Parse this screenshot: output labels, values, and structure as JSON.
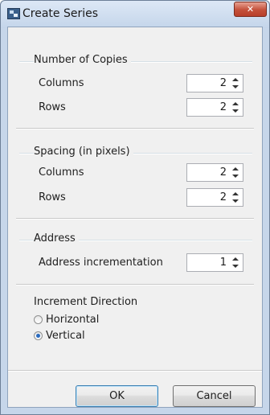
{
  "window": {
    "title": "Create Series",
    "close_symbol": "✕"
  },
  "copies": {
    "title": "Number of Copies",
    "columns_label": "Columns",
    "columns_value": "2",
    "rows_label": "Rows",
    "rows_value": "2"
  },
  "spacing": {
    "title": "Spacing (in pixels)",
    "columns_label": "Columns",
    "columns_value": "2",
    "rows_label": "Rows",
    "rows_value": "2"
  },
  "address": {
    "title": "Address",
    "increment_label": "Address incrementation",
    "increment_value": "1"
  },
  "direction": {
    "title": "Increment Direction",
    "options": [
      {
        "label": "Horizontal",
        "checked": false
      },
      {
        "label": "Vertical",
        "checked": true
      }
    ]
  },
  "buttons": {
    "ok": "OK",
    "cancel": "Cancel"
  }
}
